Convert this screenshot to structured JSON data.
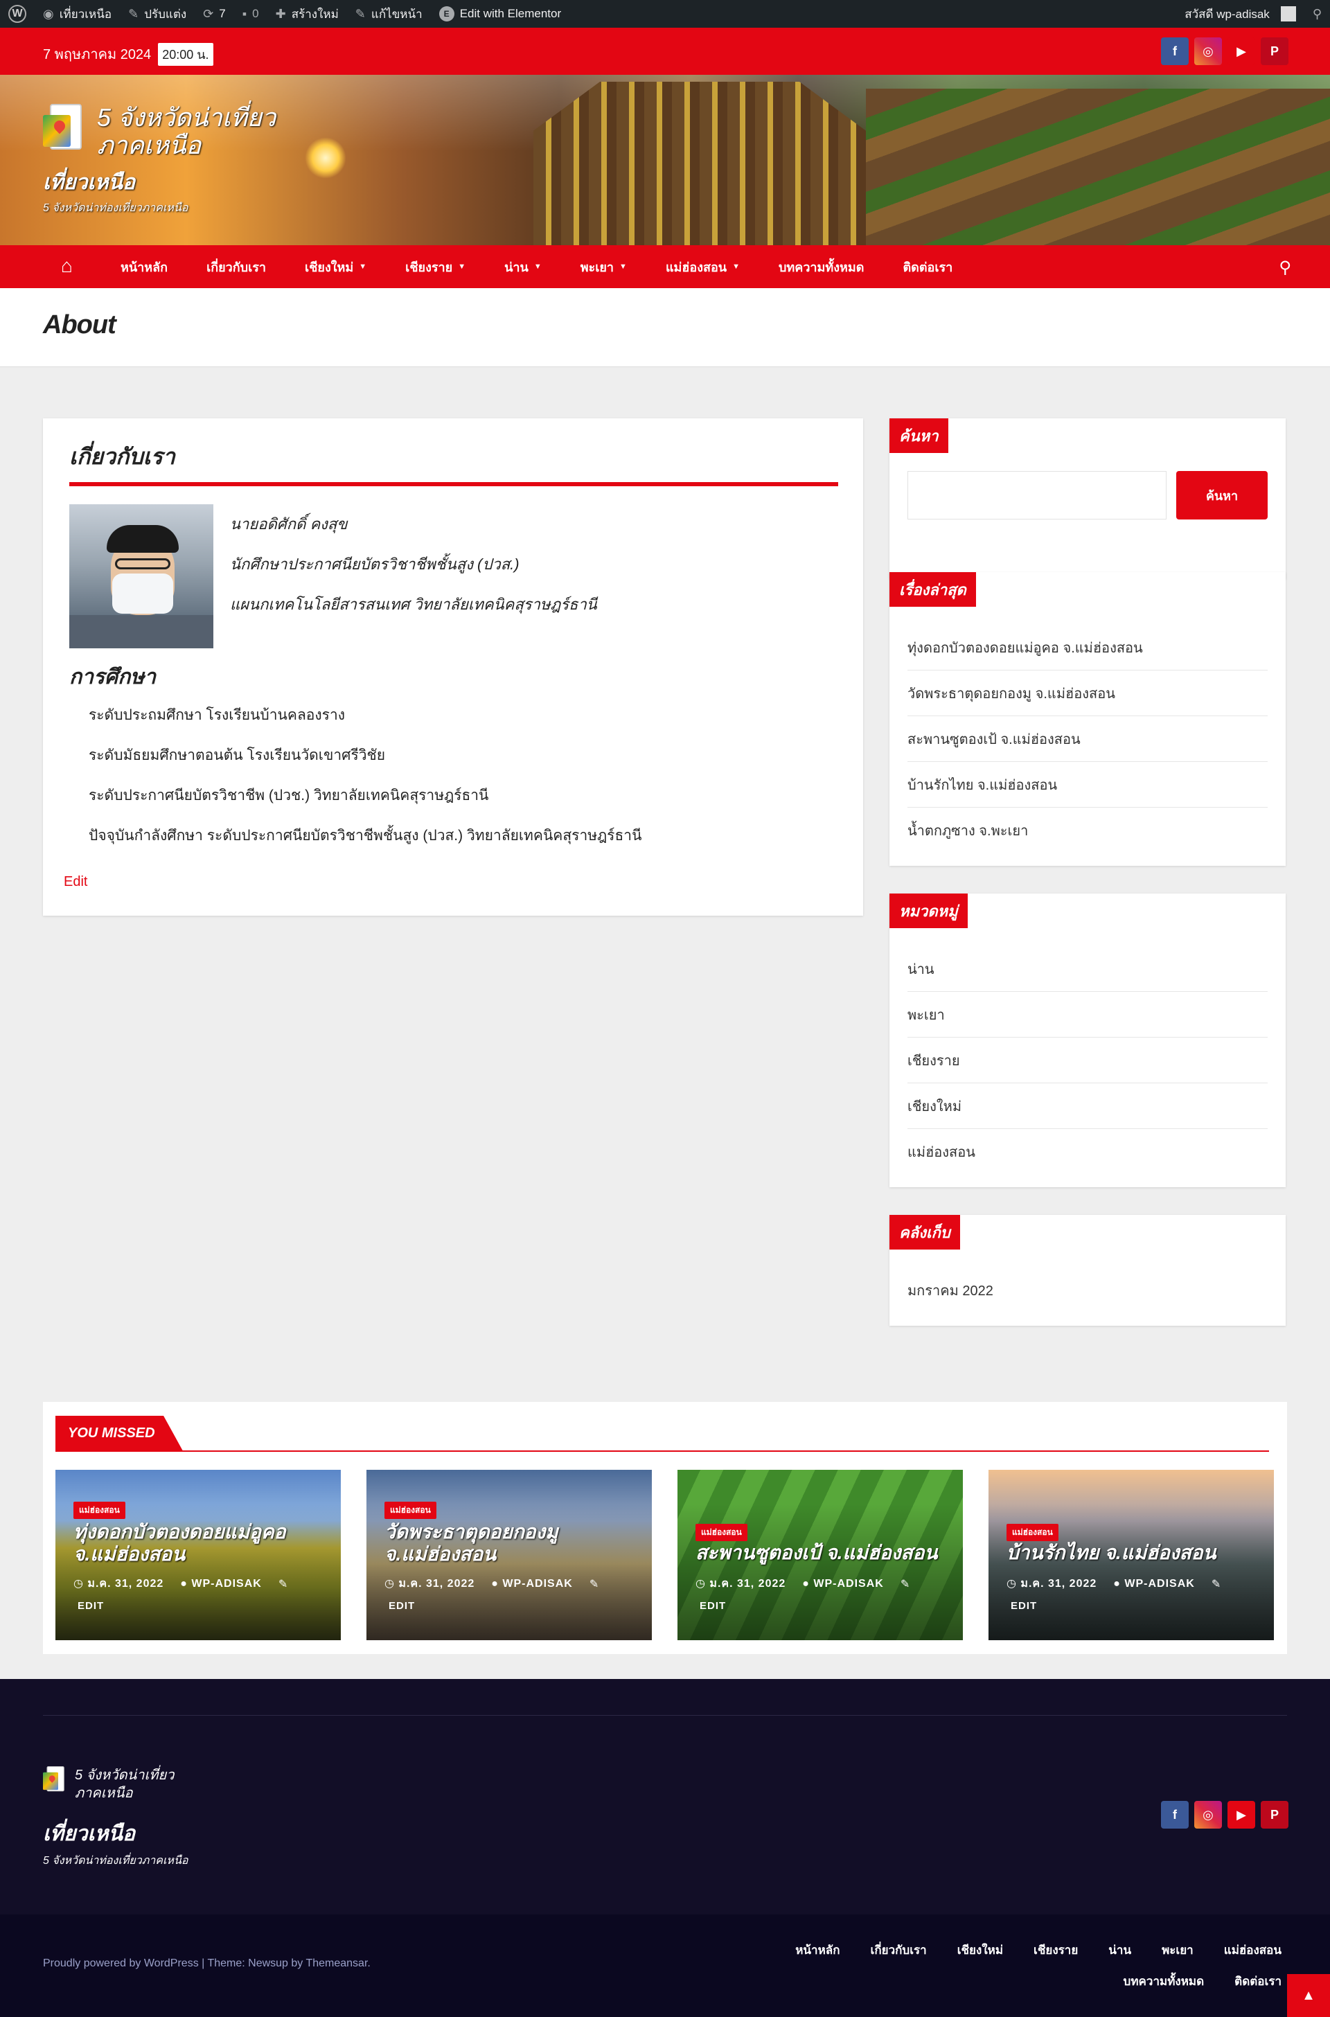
{
  "admin_bar": {
    "site_name": "เที่ยวเหนือ",
    "customize": "ปรับแต่ง",
    "updates": "7",
    "comments": "0",
    "new": "สร้างใหม่",
    "edit_page": "แก้ไขหน้า",
    "elementor": "Edit with Elementor",
    "greeting": "สวัสดี wp-adisak"
  },
  "topbar": {
    "date": "7 พฤษภาคม 2024",
    "time": "20:00 น."
  },
  "header": {
    "logo_line1": "5 จังหวัดน่าเที่ยว",
    "logo_line2": "ภาคเหนือ",
    "site_title": "เที่ยวเหนือ",
    "tagline": "5 จังหวัดน่าท่องเที่ยวภาคเหนือ"
  },
  "nav": {
    "items": [
      {
        "label": "หน้าหลัก",
        "dropdown": false
      },
      {
        "label": "เกี่ยวกับเรา",
        "dropdown": false
      },
      {
        "label": "เชียงใหม่",
        "dropdown": true
      },
      {
        "label": "เชียงราย",
        "dropdown": true
      },
      {
        "label": "น่าน",
        "dropdown": true
      },
      {
        "label": "พะเยา",
        "dropdown": true
      },
      {
        "label": "แม่ฮ่องสอน",
        "dropdown": true
      },
      {
        "label": "บทความทั้งหมด",
        "dropdown": false
      },
      {
        "label": "ติดต่อเรา",
        "dropdown": false
      }
    ]
  },
  "page": {
    "title": "About",
    "heading": "เกี่ยวกับเรา",
    "bio": [
      "นายอดิศักดิ์ คงสุข",
      "นักศึกษาประกาศนียบัตรวิชาชีพชั้นสูง (ปวส.)",
      "แผนกเทคโนโลยีสารสนเทศ วิทยาลัยเทคนิคสุราษฎร์ธานี"
    ],
    "education_title": "การศึกษา",
    "education": [
      "ระดับประถมศึกษา โรงเรียนบ้านคลองราง",
      "ระดับมัธยมศึกษาตอนต้น โรงเรียนวัดเขาศรีวิชัย",
      "ระดับประกาศนียบัตรวิชาชีพ (ปวช.) วิทยาลัยเทคนิคสุราษฎร์ธานี",
      "ปัจจุบันกำลังศึกษา ระดับประกาศนียบัตรวิชาชีพชั้นสูง (ปวส.) วิทยาลัยเทคนิคสุราษฎร์ธานี"
    ],
    "edit": "Edit"
  },
  "sidebar": {
    "search": {
      "title": "ค้นหา",
      "button": "ค้นหา",
      "value": ""
    },
    "recent": {
      "title": "เรื่องล่าสุด",
      "items": [
        "ทุ่งดอกบัวตองดอยแม่อูคอ จ.แม่ฮ่องสอน",
        "วัดพระธาตุดอยกองมู จ.แม่ฮ่องสอน",
        "สะพานซูตองเป้ จ.แม่ฮ่องสอน",
        "บ้านรักไทย จ.แม่ฮ่องสอน",
        "น้ำตกภูซาง จ.พะเยา"
      ]
    },
    "categories": {
      "title": "หมวดหมู่",
      "items": [
        "น่าน",
        "พะเยา",
        "เชียงราย",
        "เชียงใหม่",
        "แม่ฮ่องสอน"
      ]
    },
    "archives": {
      "title": "คลังเก็บ",
      "items": [
        "มกราคม 2022"
      ]
    }
  },
  "you_missed": {
    "title": "YOU MISSED",
    "cards": [
      {
        "category": "แม่ฮ่องสอน",
        "title": "ทุ่งดอกบัวตองดอยแม่อูคอ จ.แม่ฮ่องสอน",
        "date": "ม.ค. 31, 2022",
        "author": "WP-ADISAK",
        "edit": "EDIT"
      },
      {
        "category": "แม่ฮ่องสอน",
        "title": "วัดพระธาตุดอยกองมู จ.แม่ฮ่องสอน",
        "date": "ม.ค. 31, 2022",
        "author": "WP-ADISAK",
        "edit": "EDIT"
      },
      {
        "category": "แม่ฮ่องสอน",
        "title": "สะพานซูตองเป้ จ.แม่ฮ่องสอน",
        "date": "ม.ค. 31, 2022",
        "author": "WP-ADISAK",
        "edit": "EDIT"
      },
      {
        "category": "แม่ฮ่องสอน",
        "title": "บ้านรักไทย จ.แม่ฮ่องสอน",
        "date": "ม.ค. 31, 2022",
        "author": "WP-ADISAK",
        "edit": "EDIT"
      }
    ]
  },
  "footer": {
    "logo_line1": "5 จังหวัดน่าเที่ยว",
    "logo_line2": "ภาคเหนือ",
    "site_title": "เที่ยวเหนือ",
    "tagline": "5 จังหวัดน่าท่องเที่ยวภาคเหนือ",
    "copyright": "Proudly powered by WordPress | Theme: Newsup by Themeansar.",
    "nav": [
      "หน้าหลัก",
      "เกี่ยวกับเรา",
      "เชียงใหม่",
      "เชียงราย",
      "น่าน",
      "พะเยา",
      "แม่ฮ่องสอน",
      "บทความทั้งหมด",
      "ติดต่อเรา"
    ]
  }
}
